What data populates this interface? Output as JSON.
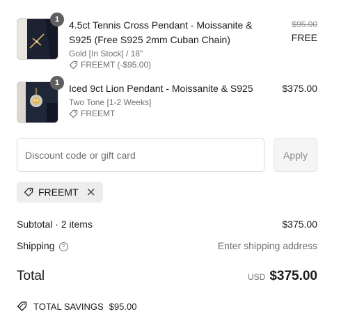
{
  "items": [
    {
      "quantity": "1",
      "title": "4.5ct Tennis Cross Pendant - Moissanite & S925 (Free S925 2mm Cuban Chain)",
      "variant": "Gold [In Stock] / 18\"",
      "discount_code": "FREEMT (-$95.00)",
      "original_price": "$95.00",
      "price": "FREE",
      "image_icon": "cross-pendant-thumbnail"
    },
    {
      "quantity": "1",
      "title": "Iced 9ct Lion Pendant - Moissanite & S925",
      "variant": "Two Tone [1-2 Weeks]",
      "discount_code": "FREEMT",
      "price": "$375.00",
      "image_icon": "lion-pendant-thumbnail"
    }
  ],
  "discount": {
    "placeholder": "Discount code or gift card",
    "apply_label": "Apply",
    "applied_code": "FREEMT"
  },
  "summary": {
    "subtotal_label": "Subtotal · 2 items",
    "subtotal_value": "$375.00",
    "shipping_label": "Shipping",
    "shipping_value": "Enter shipping address",
    "total_label": "Total",
    "currency": "USD",
    "total_value": "$375.00",
    "savings_label": "TOTAL SAVINGS",
    "savings_value": "$95.00"
  },
  "colors": {
    "text": "#1a1a1a",
    "muted": "#707070",
    "badge": "#5f5f5f",
    "chip_bg": "#ededed"
  }
}
